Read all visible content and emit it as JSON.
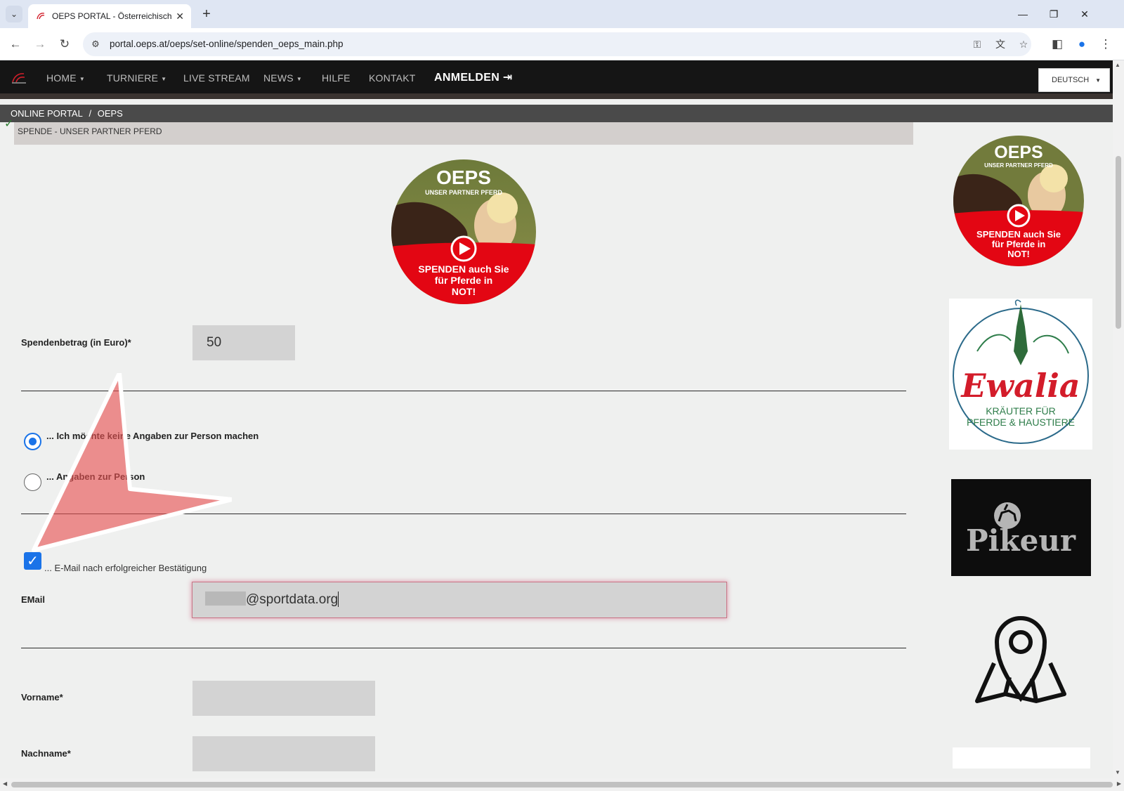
{
  "browser": {
    "tab_title": "OEPS PORTAL - Österreichische",
    "url": "portal.oeps.at/oeps/set-online/spenden_oeps_main.php"
  },
  "nav": {
    "items": [
      {
        "label": "HOME",
        "has_caret": true
      },
      {
        "label": "TURNIERE",
        "has_caret": true
      },
      {
        "label": "LIVE STREAM",
        "has_caret": false
      },
      {
        "label": "NEWS",
        "has_caret": true
      },
      {
        "label": "HILFE",
        "has_caret": false
      },
      {
        "label": "KONTAKT",
        "has_caret": false
      }
    ],
    "login_label": "ANMELDEN",
    "language": "DEUTSCH"
  },
  "breadcrumb": [
    "ONLINE PORTAL",
    "/",
    "OEPS"
  ],
  "section_title": "SPENDE - UNSER PARTNER PFERD",
  "badge": {
    "brand": "OEPS",
    "tagline": "UNSER PARTNER PFERD",
    "cta_line1": "SPENDEN auch Sie",
    "cta_line2": "für Pferde in",
    "cta_line3": "NOT!"
  },
  "form": {
    "amount_label": "Spendenbetrag (in Euro)*",
    "amount_value": "50",
    "radio_no_details": "... Ich möchte keine Angaben zur Person machen",
    "radio_details": "... Angaben zur Person",
    "radio_selected": "no_details",
    "email_checkbox_label": "... E-Mail nach erfolgreicher Bestätigung",
    "email_checkbox_checked": true,
    "email_label": "EMail",
    "email_value": "@sportdata.org",
    "firstname_label": "Vorname*",
    "lastname_label": "Nachname*"
  },
  "sponsors": {
    "evalia_name": "Ewalia",
    "evalia_line1": "KRÄUTER FÜR",
    "evalia_line2": "PFERDE & HAUSTIERE",
    "pikeur_name": "Pikeur"
  },
  "colors": {
    "nav_bg": "#151515",
    "brand_red": "#e30613",
    "focus_red": "#c97284",
    "check_blue": "#1a73e8"
  }
}
